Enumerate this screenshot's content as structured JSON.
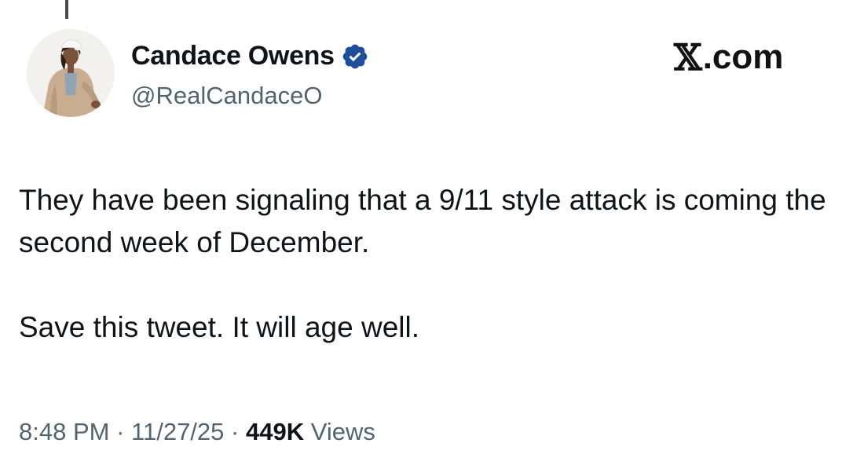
{
  "author": {
    "display_name": "Candace Owens",
    "handle": "@RealCandaceO",
    "verified": true,
    "verified_icon": "verified-badge-icon",
    "avatar": "profile-avatar"
  },
  "brand": {
    "x_glyph": "𝕏",
    "suffix": ".com"
  },
  "tweet": {
    "paragraphs": [
      "They have been signaling that a 9/11 style attack is coming the second week of December.",
      "Save this tweet. It will age well."
    ],
    "time": "8:48 PM",
    "date": "11/27/25",
    "separator": "·",
    "views_count": "449K",
    "views_label": "Views"
  },
  "colors": {
    "text": "#0f1419",
    "secondary": "#536471",
    "verified": "#1d4f9c"
  }
}
